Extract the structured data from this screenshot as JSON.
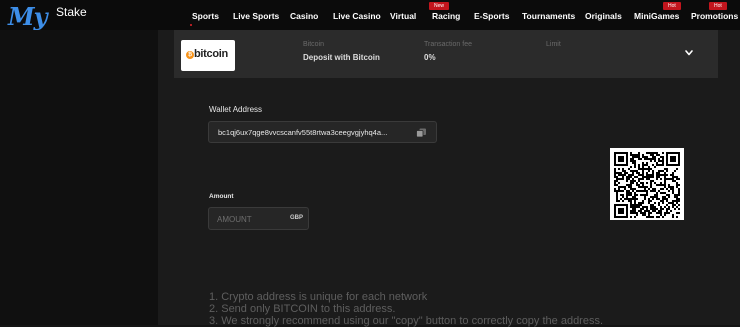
{
  "brand": {
    "logo_script": "My",
    "logo_word": "Stake"
  },
  "nav": {
    "items": [
      "Sports",
      "Live Sports",
      "Casino",
      "Live Casino",
      "Virtual",
      "Racing",
      "E-Sports",
      "Tournaments",
      "Originals",
      "MiniGames",
      "Promotions"
    ],
    "badges": {
      "racing": "New",
      "minigames": "Hot",
      "promotions": "Hot"
    }
  },
  "method": {
    "logo_text": "bitcoin",
    "currency_label": "Bitcoin",
    "currency_value": "Deposit with Bitcoin",
    "fee_label": "Transaction fee",
    "fee_value": "0%",
    "limit_label": "Limit",
    "limit_value": ""
  },
  "wallet": {
    "label": "Wallet Address",
    "address": "bc1qj6ux7qge8vvcscanfv55t8rtwa3ceegvgjyhq4a..."
  },
  "amount": {
    "label": "Amount",
    "placeholder": "AMOUNT",
    "currency": "GBP"
  },
  "notes": [
    "1. Crypto address is unique for each network",
    "2. Send only BITCOIN to this address.",
    "3. We strongly recommend using our \"copy\" button to correctly copy the address."
  ],
  "colors": {
    "accent_blue": "#3d8ee8",
    "badge_red": "#c2151d",
    "bitcoin_orange": "#f7931a"
  },
  "icons": {
    "copy": "copy-icon",
    "expand": "chevron-down-icon",
    "qr": "qr-code"
  }
}
